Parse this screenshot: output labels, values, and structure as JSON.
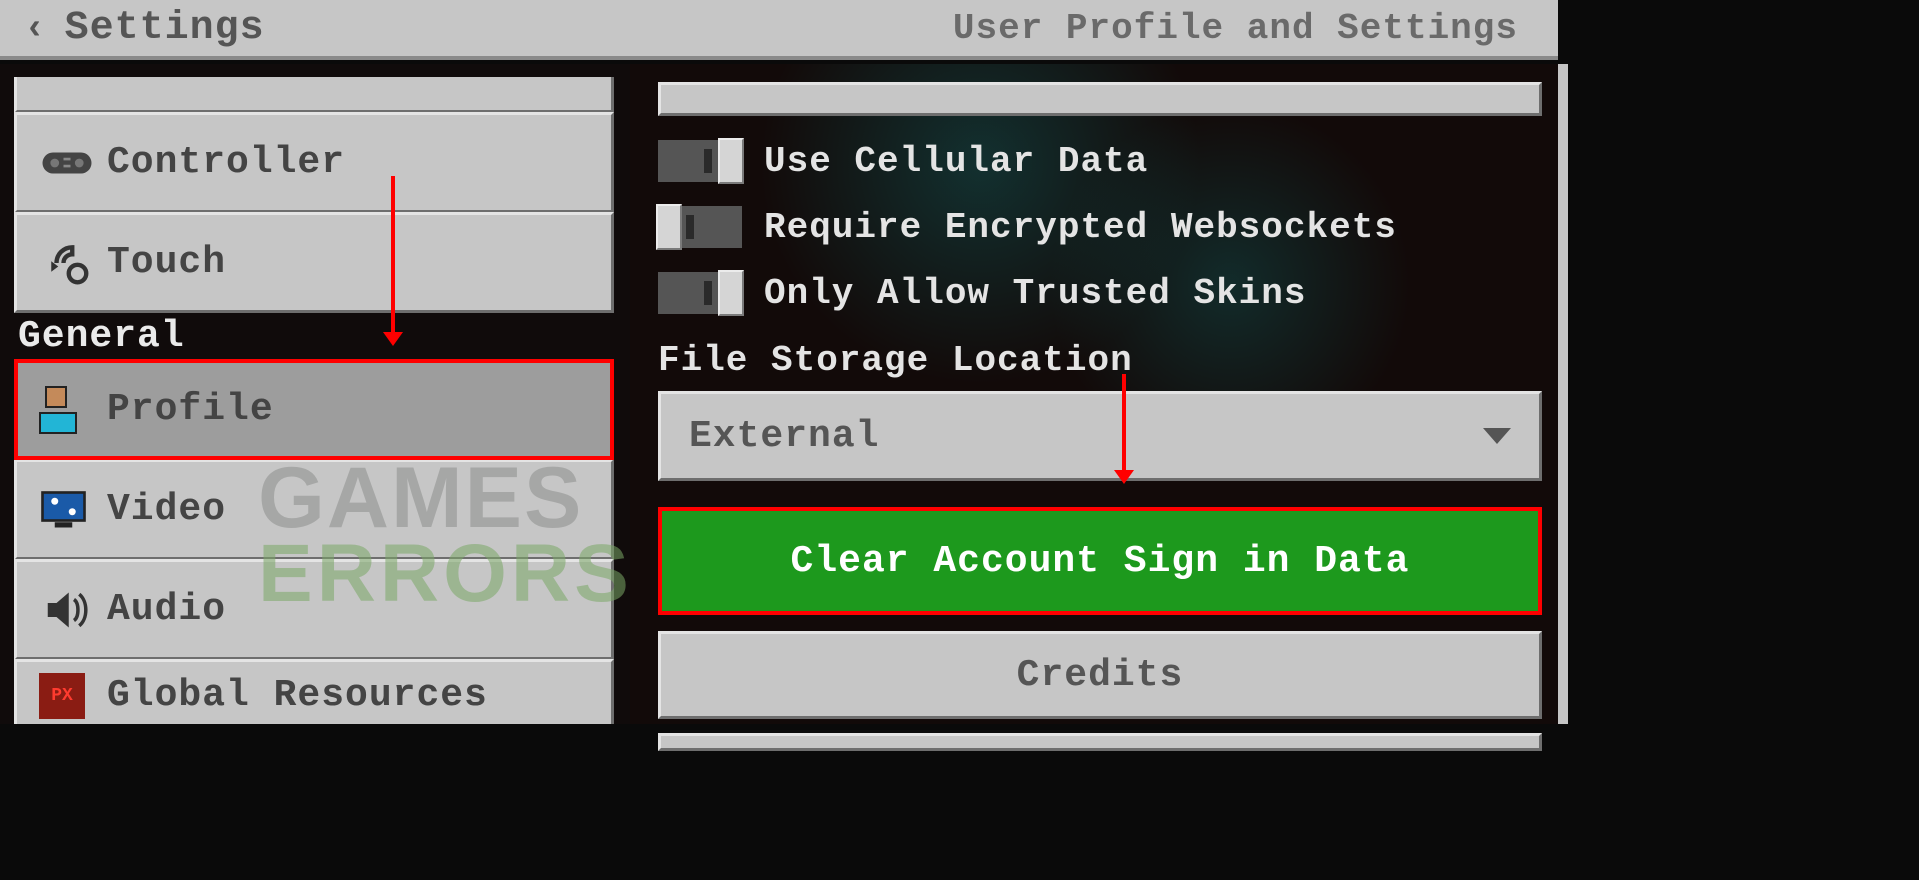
{
  "header": {
    "title": "Settings",
    "subtitle": "User Profile and Settings"
  },
  "sidebar": {
    "section_label": "General",
    "items": {
      "controller": "Controller",
      "touch": "Touch",
      "profile": "Profile",
      "video": "Video",
      "audio": "Audio",
      "global_resources": "Global Resources"
    }
  },
  "content": {
    "toggles": {
      "cellular": {
        "label": "Use Cellular Data",
        "state": "off"
      },
      "websockets": {
        "label": "Require Encrypted Websockets",
        "state": "on"
      },
      "trusted_skins": {
        "label": "Only Allow Trusted Skins",
        "state": "off"
      }
    },
    "storage": {
      "label": "File Storage Location",
      "value": "External"
    },
    "buttons": {
      "clear_signin": "Clear Account Sign in Data",
      "credits": "Credits"
    }
  },
  "watermark": {
    "line1": "GAMES",
    "line2": "ERRORS"
  },
  "annotations": {
    "highlighted_sidebar_item": "profile",
    "highlighted_button": "clear_signin"
  }
}
